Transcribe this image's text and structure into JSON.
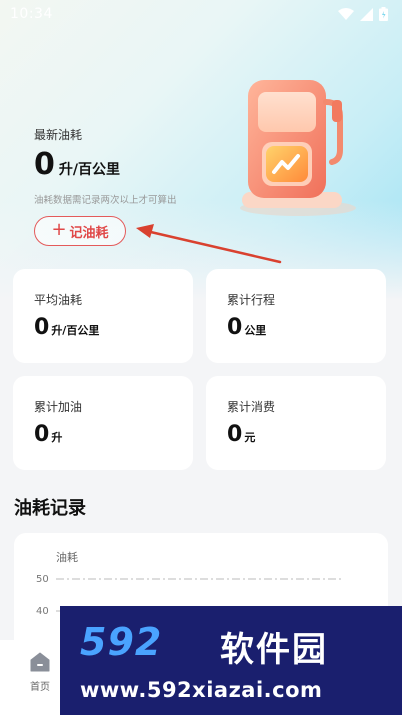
{
  "status_bar": {
    "time": "10:34"
  },
  "hero": {
    "latest_label": "最新油耗",
    "latest_value": "0",
    "latest_unit": "升/百公里",
    "hint": "油耗数据需记录两次以上才可算出",
    "record_button_plus": "+",
    "record_button_label": "记油耗"
  },
  "stats": [
    {
      "label": "平均油耗",
      "value": "0",
      "unit": "升/百公里"
    },
    {
      "label": "累计行程",
      "value": "0",
      "unit": "公里"
    },
    {
      "label": "累计加油",
      "value": "0",
      "unit": "升"
    },
    {
      "label": "累计消费",
      "value": "0",
      "unit": "元"
    }
  ],
  "records_section": {
    "title": "油耗记录"
  },
  "chart_data": {
    "type": "line",
    "ylabel": "油耗",
    "y_ticks": [
      "50",
      "40"
    ],
    "series": []
  },
  "tabbar": {
    "home_label": "首页"
  },
  "watermark": {
    "logo": "592",
    "brand": "软件园",
    "url": "www.592xiazai.com"
  },
  "colors": {
    "accent": "#e04848",
    "background": "#f4f5f7",
    "card": "#ffffff"
  }
}
